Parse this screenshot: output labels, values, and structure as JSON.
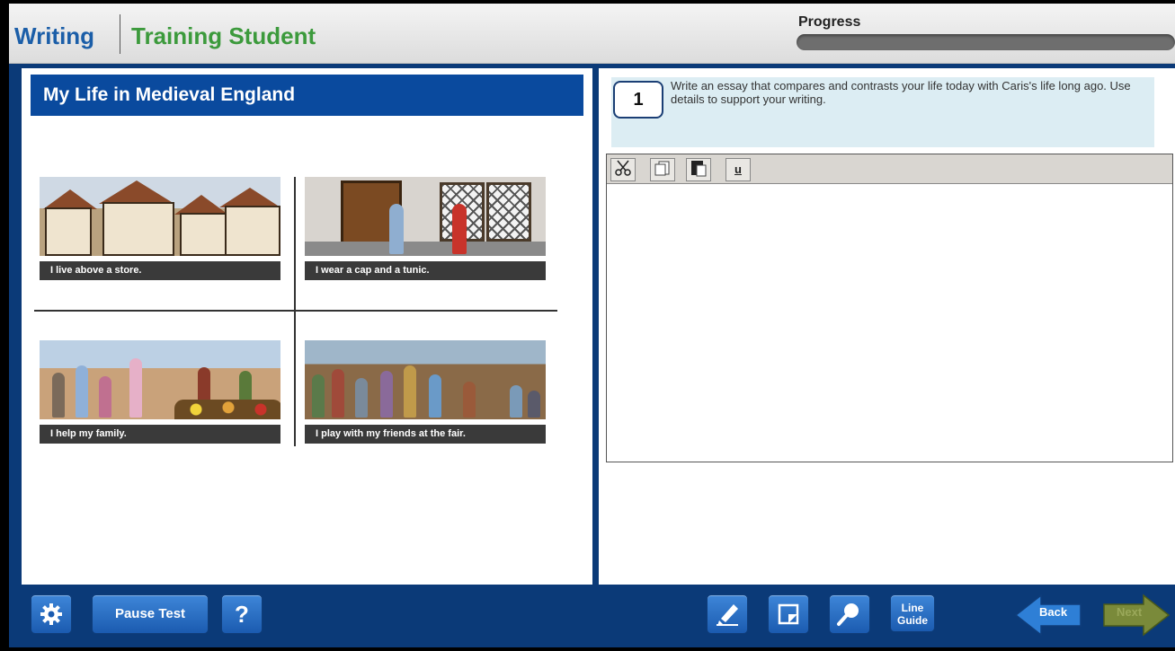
{
  "header": {
    "subject": "Writing",
    "user": "Training Student",
    "progress_label": "Progress",
    "progress_value": 0
  },
  "passage": {
    "title": "My Life in Medieval England",
    "cards": [
      {
        "caption": "I live above a store."
      },
      {
        "caption": "I wear a cap and a tunic."
      },
      {
        "caption": "I help my family."
      },
      {
        "caption": "I play with my friends at the fair."
      }
    ]
  },
  "question": {
    "number": "1",
    "text": "Write an essay that compares and contrasts your life today with Caris's life long ago. Use details to support your writing."
  },
  "editor": {
    "tools": [
      "cut-icon",
      "copy-icon",
      "paste-icon",
      "underline-icon"
    ],
    "underline_label": "u",
    "value": ""
  },
  "footer": {
    "settings_icon": "gear-icon",
    "pause_label": "Pause Test",
    "help_label": "?",
    "highlighter_icon": "highlighter-icon",
    "notepad_icon": "notepad-icon",
    "zoom_icon": "magnifier-icon",
    "line_guide_label_1": "Line",
    "line_guide_label_2": "Guide",
    "back_label": "Back",
    "next_label": "Next"
  },
  "colors": {
    "frame": "#0b3a78",
    "title_bar": "#0a4a9e",
    "subject": "#1b5ea8",
    "user": "#3c9a3c",
    "question_bg": "#dcedf3",
    "next_disabled": "#7a8a3a"
  }
}
